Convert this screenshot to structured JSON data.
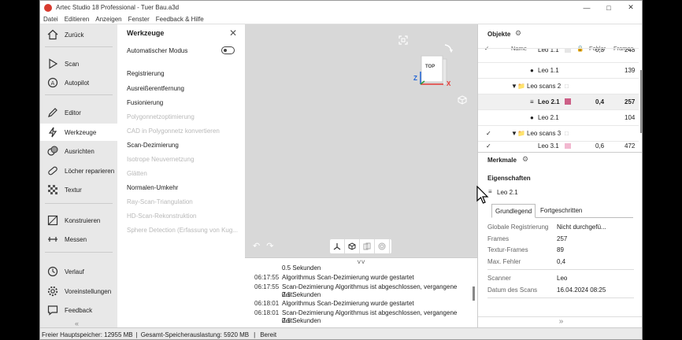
{
  "window": {
    "title": "Artec Studio 18 Professional - Tuer Bau.a3d"
  },
  "menu": [
    "Datei",
    "Editieren",
    "Anzeigen",
    "Fenster",
    "Feedback & Hilfe"
  ],
  "nav": [
    {
      "label": "Zurück",
      "icon": "home-icon"
    },
    {
      "label": "Scan",
      "icon": "play-icon"
    },
    {
      "label": "Autopilot",
      "icon": "autopilot-icon"
    },
    {
      "label": "Editor",
      "icon": "pencil-icon"
    },
    {
      "label": "Werkzeuge",
      "icon": "lightning-icon"
    },
    {
      "label": "Ausrichten",
      "icon": "align-icon"
    },
    {
      "label": "Löcher reparieren",
      "icon": "bandage-icon"
    },
    {
      "label": "Textur",
      "icon": "texture-icon"
    },
    {
      "label": "Konstruieren",
      "icon": "construct-icon"
    },
    {
      "label": "Messen",
      "icon": "measure-icon"
    },
    {
      "label": "Verlauf",
      "icon": "history-icon"
    },
    {
      "label": "Voreinstellungen",
      "icon": "gear-icon"
    },
    {
      "label": "Feedback",
      "icon": "feedback-icon"
    }
  ],
  "tools": {
    "header": "Werkzeuge",
    "auto_mode": "Automatischer Modus",
    "items": [
      {
        "label": "Registrierung",
        "enabled": true
      },
      {
        "label": "Ausreißerentfernung",
        "enabled": true
      },
      {
        "label": "Fusionierung",
        "enabled": true
      },
      {
        "label": "Polygonnetzoptimierung",
        "enabled": false
      },
      {
        "label": "CAD in Polygonnetz konvertieren",
        "enabled": false
      },
      {
        "label": "Scan-Dezimierung",
        "enabled": true
      },
      {
        "label": "Isotrope Neuvernetzung",
        "enabled": false
      },
      {
        "label": "Glätten",
        "enabled": false
      },
      {
        "label": "Normalen-Umkehr",
        "enabled": true
      },
      {
        "label": "Ray-Scan-Triangulation",
        "enabled": false
      },
      {
        "label": "HD-Scan-Rekonstruktion",
        "enabled": false
      },
      {
        "label": "Sphere Detection (Erfassung von Kug...",
        "enabled": false
      }
    ]
  },
  "viewcube": {
    "face": "TOP",
    "axis_x": "X",
    "axis_z": "Z"
  },
  "log": [
    {
      "time": "",
      "msg": "0.5 Sekunden"
    },
    {
      "time": "06:17:55",
      "msg": "Algorithmus Scan-Dezimierung wurde gestartet"
    },
    {
      "time": "06:17:55",
      "msg": "Scan-Dezimierung Algorithmus ist abgeschlossen, vergangene Zeit:"
    },
    {
      "time": "",
      "msg": "0.1 Sekunden"
    },
    {
      "time": "06:18:01",
      "msg": "Algorithmus Scan-Dezimierung wurde gestartet"
    },
    {
      "time": "06:18:01",
      "msg": "Scan-Dezimierung Algorithmus ist abgeschlossen, vergangene Zeit:"
    },
    {
      "time": "",
      "msg": "0.1 Sekunden"
    }
  ],
  "objects": {
    "title": "Objekte",
    "columns": {
      "name": "Name",
      "fehler": "Fehler",
      "frames": "Frames"
    },
    "rows": [
      {
        "name": "Leo 1.1",
        "fehler": "0,3",
        "frames": "243",
        "color": "#e6e6e6"
      },
      {
        "name": "Leo 1.1",
        "fehler": "",
        "frames": "139",
        "color": ""
      },
      {
        "name": "Leo scans 2",
        "fehler": "",
        "frames": "",
        "color": ""
      },
      {
        "name": "Leo 2.1",
        "fehler": "0,4",
        "frames": "257",
        "color": "#cc5f86"
      },
      {
        "name": "Leo 2.1",
        "fehler": "",
        "frames": "104",
        "color": ""
      },
      {
        "name": "Leo scans 3",
        "fehler": "",
        "frames": "",
        "color": ""
      },
      {
        "name": "Leo 3.1",
        "fehler": "0,6",
        "frames": "472",
        "color": "#f2b8d0"
      }
    ]
  },
  "merkmale": {
    "title": "Merkmale"
  },
  "properties": {
    "title": "Eigenschaften",
    "object": "Leo 2.1",
    "tabs": [
      "Grundlegend",
      "Fortgeschritten"
    ],
    "rows": [
      {
        "key": "Globale Registrierung",
        "value": "Nicht durchgefü..."
      },
      {
        "key": "Frames",
        "value": "257"
      },
      {
        "key": "Textur-Frames",
        "value": "89"
      },
      {
        "key": "Max. Fehler",
        "value": "0,4"
      },
      {
        "key": "Scanner",
        "value": "Leo"
      },
      {
        "key": "Datum des Scans",
        "value": "16.04.2024 08:25"
      }
    ]
  },
  "status": {
    "memory": "Freier Hauptspeicher: 12955 MB",
    "total": "Gesamt-Speicherauslastung: 5920 MB",
    "state": "Bereit"
  }
}
